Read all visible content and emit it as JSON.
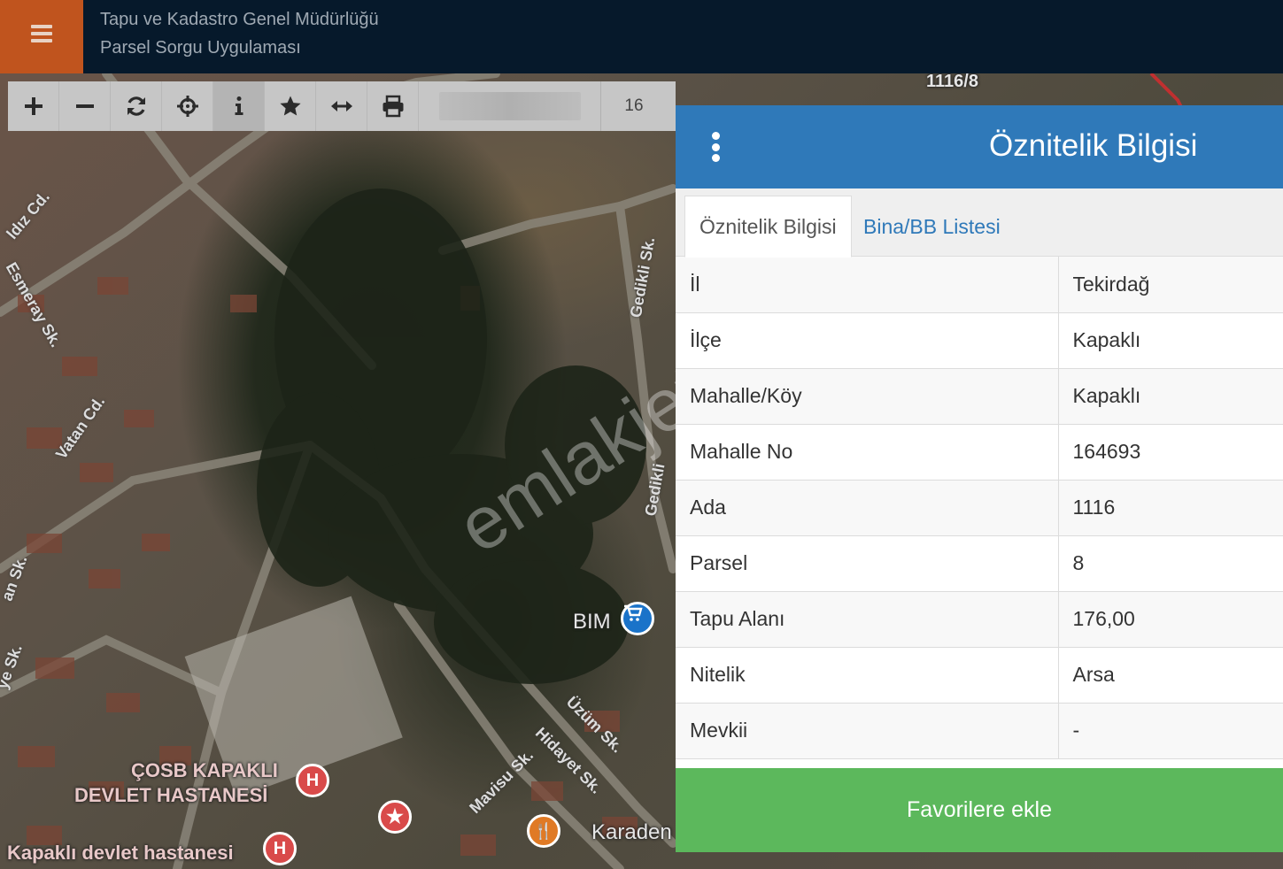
{
  "header": {
    "title_line1": "Tapu ve Kadastro Genel Müdürlüğü",
    "title_line2": "Parsel Sorgu Uygulaması",
    "menu_icon": "hamburger-icon"
  },
  "toolbar": {
    "tools": [
      "plus-icon",
      "minus-icon",
      "refresh-icon",
      "crosshair-icon",
      "info-icon",
      "star-icon",
      "measure-icon",
      "print-icon"
    ],
    "zoom_level": "16"
  },
  "map": {
    "parcel_label": "1116/8",
    "streets": [
      "ldız Cd.",
      "Esmeray Sk.",
      "Vatan Cd.",
      "Gedikli Sk.",
      "Gedikli",
      "an Sk.",
      "ye Sk.",
      "Üzüm Sk.",
      "Hidayet Sk.",
      "Mavisu Sk."
    ],
    "poi_labels": [
      "BIM",
      "ÇOSB KAPAKLI",
      "DEVLET HASTANESİ",
      "Kapaklı devlet hastanesi",
      "Karaden"
    ],
    "watermark": "emlakjet.com"
  },
  "panel": {
    "title": "Öznitelik Bilgisi",
    "tabs": [
      {
        "label": "Öznitelik Bilgisi",
        "active": true
      },
      {
        "label": "Bina/BB Listesi",
        "active": false
      }
    ],
    "rows": [
      {
        "key": "İl",
        "value": "Tekirdağ"
      },
      {
        "key": "İlçe",
        "value": "Kapaklı"
      },
      {
        "key": "Mahalle/Köy",
        "value": "Kapaklı"
      },
      {
        "key": "Mahalle No",
        "value": "164693"
      },
      {
        "key": "Ada",
        "value": "1116"
      },
      {
        "key": "Parsel",
        "value": "8"
      },
      {
        "key": "Tapu Alanı",
        "value": "176,00"
      },
      {
        "key": "Nitelik",
        "value": "Arsa"
      },
      {
        "key": "Mevkii",
        "value": "-"
      }
    ],
    "favorite_button": "Favorilere ekle"
  },
  "colors": {
    "header_bg": "#06192b",
    "menu_bg": "#c0541e",
    "panel_header": "#2f79b9",
    "favorite_button": "#5cb85c"
  }
}
